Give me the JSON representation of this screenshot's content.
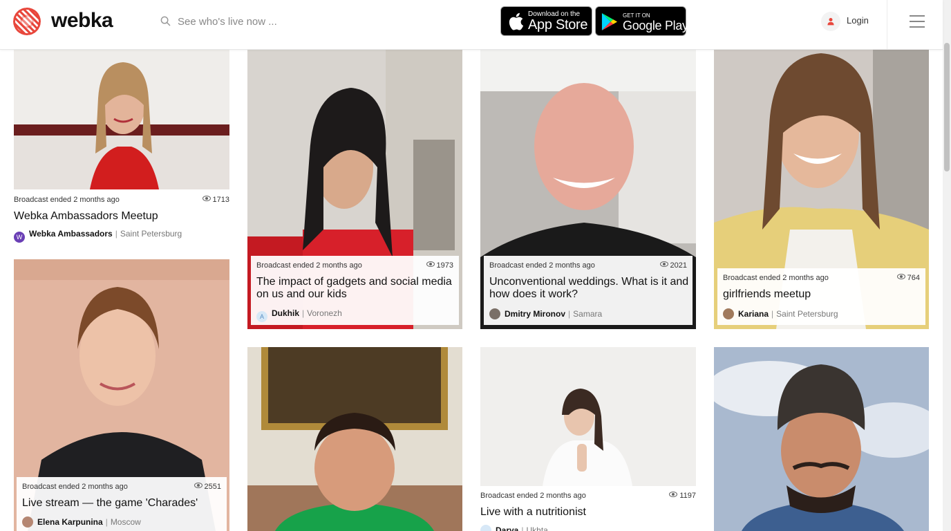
{
  "header": {
    "brand": "webka",
    "search_placeholder": "See who's live now ...",
    "appstore": {
      "small": "Download on the",
      "big": "App Store"
    },
    "googleplay": {
      "small": "GET IT ON",
      "big": "Google Play"
    },
    "login_label": "Login"
  },
  "colors": {
    "brand": "#e8473c",
    "panel": "#ffffff"
  },
  "cards": [
    {
      "status": "Broadcast ended 2 months ago",
      "views": "1713",
      "title": "Webka Ambassadors Meetup",
      "author": "Webka Ambassadors",
      "city": "Saint Petersburg"
    },
    {
      "status": "Broadcast ended 2 months ago",
      "views": "1973",
      "title": "The impact of gadgets and social media on us and our kids",
      "author": "Dukhik",
      "city": "Voronezh"
    },
    {
      "status": "Broadcast ended 2 months ago",
      "views": "2021",
      "title": "Unconventional weddings. What is it and how does it work?",
      "author": "Dmitry Mironov",
      "city": "Samara"
    },
    {
      "status": "Broadcast ended 2 months ago",
      "views": "764",
      "title": "girlfriends meetup",
      "author": "Kariana",
      "city": "Saint Petersburg"
    },
    {
      "status": "Broadcast ended 2 months ago",
      "views": "2551",
      "title": "Live stream — the game 'Charades'",
      "author": "Elena Karpunina",
      "city": "Moscow"
    },
    {
      "status": "Broadcast ended 2 months ago",
      "views": "1197",
      "title": "Live with a nutritionist",
      "author": "Darya",
      "city": "Ukhta"
    }
  ]
}
